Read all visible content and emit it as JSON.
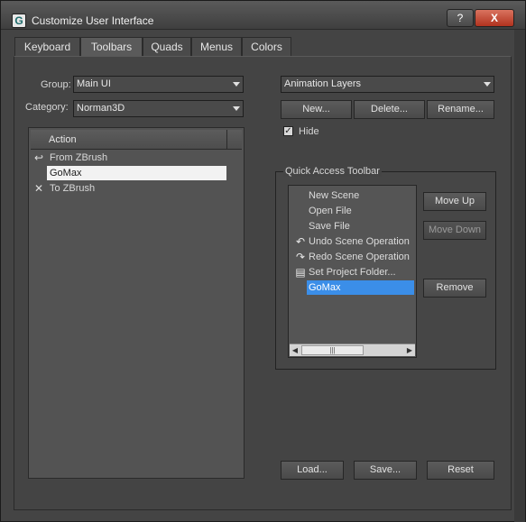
{
  "window": {
    "title": "Customize User Interface",
    "icon": "3ds-max-logo-icon",
    "help_label": "?",
    "close_label": "X"
  },
  "tabs": [
    {
      "label": "Keyboard"
    },
    {
      "label": "Toolbars"
    },
    {
      "label": "Quads"
    },
    {
      "label": "Menus"
    },
    {
      "label": "Colors"
    }
  ],
  "active_tab": "Toolbars",
  "left": {
    "group_label": "Group:",
    "group_value": "Main UI",
    "category_label": "Category:",
    "category_value": "Norman3D",
    "list_header": "Action",
    "items": [
      {
        "label": "From ZBrush",
        "icon": "zbrush-import-icon",
        "selected": false
      },
      {
        "label": "GoMax",
        "icon": "",
        "selected": true
      },
      {
        "label": "To ZBrush",
        "icon": "zbrush-export-icon",
        "selected": false
      }
    ]
  },
  "right": {
    "toolbar_select": "Animation Layers",
    "new_label": "New...",
    "delete_label": "Delete...",
    "rename_label": "Rename...",
    "hide_label": "Hide",
    "hide_checked": true,
    "group_title": "Quick Access Toolbar",
    "qa_items": [
      {
        "label": "New Scene",
        "icon": "",
        "selected": false
      },
      {
        "label": "Open File",
        "icon": "",
        "selected": false
      },
      {
        "label": "Save File",
        "icon": "",
        "selected": false
      },
      {
        "label": "Undo Scene Operation",
        "icon": "undo-icon",
        "selected": false
      },
      {
        "label": "Redo Scene Operation",
        "icon": "redo-icon",
        "selected": false
      },
      {
        "label": "Set Project Folder...",
        "icon": "project-folder-icon",
        "selected": false
      },
      {
        "label": "GoMax",
        "icon": "",
        "selected": true
      }
    ],
    "move_up_label": "Move Up",
    "move_down_label": "Move Down",
    "remove_label": "Remove"
  },
  "footer": {
    "load_label": "Load...",
    "save_label": "Save...",
    "reset_label": "Reset"
  },
  "colors": {
    "selection": "#3b8ee8",
    "close_button": "#c0432e"
  }
}
